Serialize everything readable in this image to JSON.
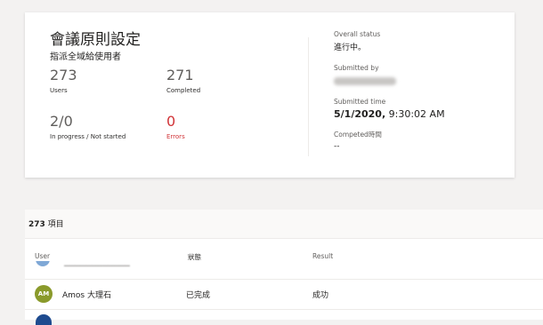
{
  "summary": {
    "title": "會議原則設定",
    "subtitle": "指派全域給使用者",
    "stats": [
      {
        "value": "273",
        "label": "Users"
      },
      {
        "value": "271",
        "label": "Completed"
      },
      {
        "value": "2/0",
        "label": "In progress / Not started"
      },
      {
        "value": "0",
        "label": "Errors"
      }
    ],
    "meta": {
      "overall_status_label": "Overall status",
      "overall_status_value": "進行中。",
      "submitted_by_label": "Submitted by",
      "submitted_time_label": "Submitted time",
      "submitted_time_date": "5/1/2020,",
      "submitted_time_time": " 9:30:02 AM",
      "completed_label": "Competed時間",
      "completed_value": "--"
    }
  },
  "list": {
    "count": "273",
    "count_suffix": " 項目",
    "columns": {
      "user": "User",
      "status": "狀態",
      "result": "Result"
    },
    "rows": [
      {
        "initials": "AM",
        "name": "Amos 大理石",
        "status": "已完成",
        "result": "成功"
      }
    ]
  },
  "colors": {
    "error": "#d13438",
    "avatar_am": "#8a9a2b",
    "background": "#f3f2f1"
  }
}
